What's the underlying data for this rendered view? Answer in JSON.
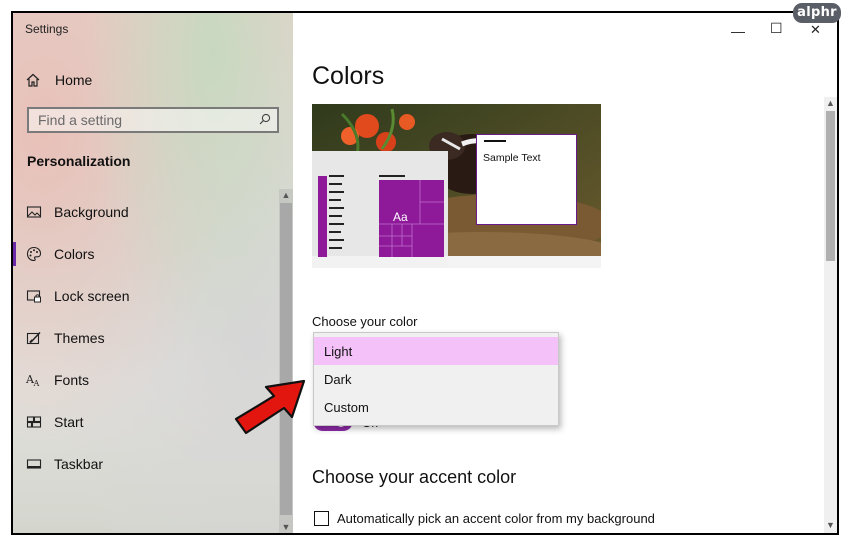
{
  "brand": "alphr",
  "window": {
    "title": "Settings",
    "controls": {
      "minimize": "—",
      "maximize": "☐",
      "close": "✕"
    }
  },
  "sidebar": {
    "home_label": "Home",
    "search": {
      "placeholder": "Find a setting"
    },
    "section_title": "Personalization",
    "items": [
      {
        "label": "Background",
        "icon": "image-icon",
        "active": false
      },
      {
        "label": "Colors",
        "icon": "palette-icon",
        "active": true
      },
      {
        "label": "Lock screen",
        "icon": "lock-screen-icon",
        "active": false
      },
      {
        "label": "Themes",
        "icon": "themes-icon",
        "active": false
      },
      {
        "label": "Fonts",
        "icon": "fonts-icon",
        "active": false
      },
      {
        "label": "Start",
        "icon": "start-icon",
        "active": false
      },
      {
        "label": "Taskbar",
        "icon": "taskbar-icon",
        "active": false
      }
    ]
  },
  "main": {
    "title": "Colors",
    "preview": {
      "sample_text": "Sample Text",
      "tile_text": "Aa"
    },
    "choose_color": {
      "label": "Choose your color",
      "options": [
        "Light",
        "Dark",
        "Custom"
      ],
      "selected": "Light"
    },
    "toggle": {
      "state_label": "On",
      "on": true
    },
    "accent": {
      "title": "Choose your accent color",
      "auto_pick_label": "Automatically pick an accent color from my background",
      "auto_pick_checked": false
    }
  },
  "colors": {
    "accent": "#8e2aa8",
    "selection": "#f4c2f8",
    "annotation_arrow": "#e3160f"
  }
}
